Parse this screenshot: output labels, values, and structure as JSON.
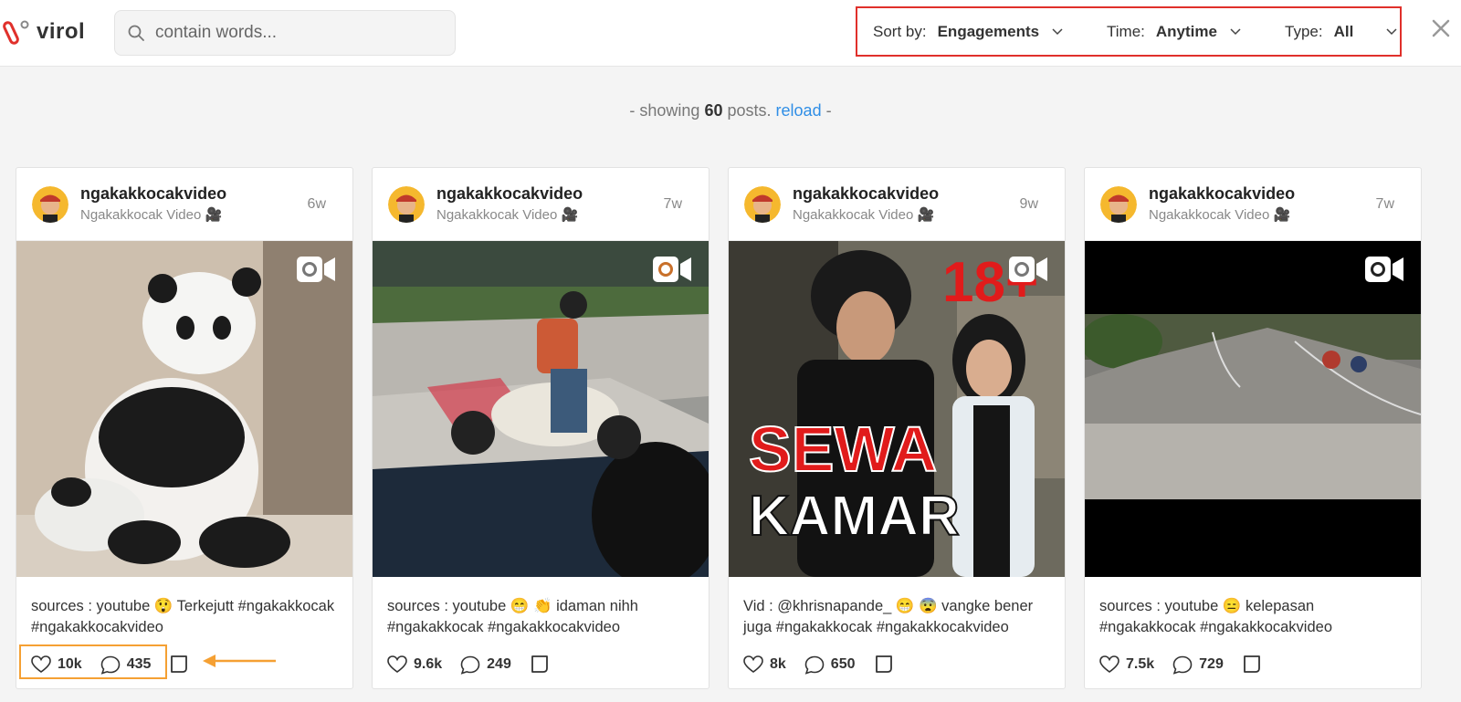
{
  "brand": {
    "name": "virol"
  },
  "search": {
    "placeholder": "contain words..."
  },
  "filters": {
    "sort": {
      "label": "Sort by:",
      "value": "Engagements"
    },
    "time": {
      "label": "Time:",
      "value": "Anytime"
    },
    "type": {
      "label": "Type:",
      "value": "All"
    }
  },
  "status": {
    "prefix": "- showing",
    "count": "60",
    "mid": "posts.",
    "reload": "reload",
    "suffix": "-"
  },
  "posts": [
    {
      "username": "ngakakkocakvideo",
      "display_name": "Ngakakkocak Video 🎥",
      "age": "6w",
      "caption": "sources : youtube 😲  Terkejutt #ngakakkocak #ngakakkocakvideo",
      "likes": "10k",
      "comments": "435"
    },
    {
      "username": "ngakakkocakvideo",
      "display_name": "Ngakakkocak Video 🎥",
      "age": "7w",
      "caption": "sources : youtube 😁  👏  idaman nihh #ngakakkocak #ngakakkocakvideo",
      "likes": "9.6k",
      "comments": "249"
    },
    {
      "username": "ngakakkocakvideo",
      "display_name": "Ngakakkocak Video 🎥",
      "age": "9w",
      "caption": "Vid : @khrisnapande_ 😁 😨  vangke bener juga #ngakakkocak #ngakakkocakvideo",
      "likes": "8k",
      "comments": "650",
      "overlay": {
        "top": "18+",
        "line1": "SEWA",
        "line2": "KAMAR"
      }
    },
    {
      "username": "ngakakkocakvideo",
      "display_name": "Ngakakkocak Video 🎥",
      "age": "7w",
      "caption": "sources : youtube 😑  kelepasan #ngakakkocak #ngakakkocakvideo",
      "likes": "7.5k",
      "comments": "729"
    }
  ],
  "colors": {
    "accent": "#e0302b",
    "highlight": "#f5a033",
    "link": "#2f8ee6"
  },
  "icons": [
    "search-icon",
    "chevron-down-icon",
    "close-icon",
    "heart-icon",
    "comment-icon",
    "bookmark-icon",
    "video-camera-icon"
  ]
}
